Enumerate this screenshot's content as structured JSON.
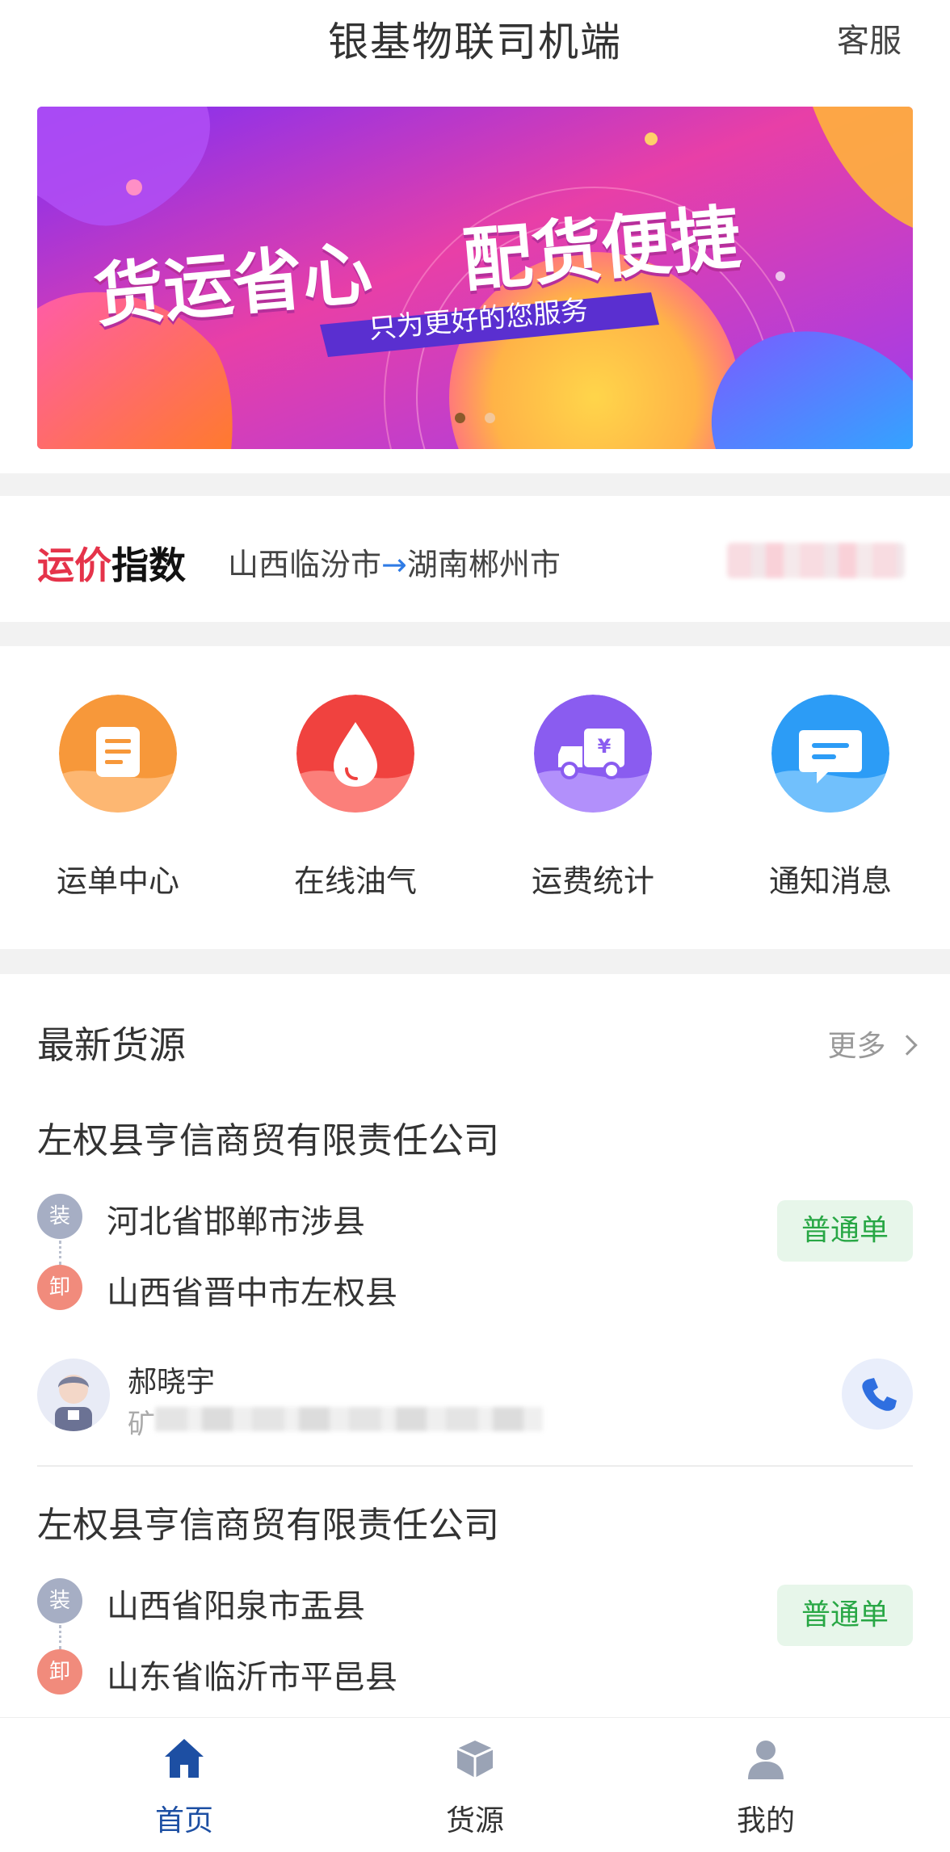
{
  "header": {
    "title": "银基物联司机端",
    "service_label": "客服"
  },
  "banner": {
    "headline_left": "货运省心",
    "headline_right": "配货便捷",
    "sub": "只为更好的您服务",
    "slide_count": 2,
    "active_slide": 1
  },
  "price_index": {
    "logo_red": "运价",
    "logo_black": "指数",
    "route_from": "山西临汾市",
    "route_arrow": "→",
    "route_to": "湖南郴州市"
  },
  "quick_menu": [
    {
      "label": "运单中心",
      "icon": "order-doc-icon",
      "color": "#f7983a"
    },
    {
      "label": "在线油气",
      "icon": "fuel-drop-icon",
      "color": "#f0423f"
    },
    {
      "label": "运费统计",
      "icon": "truck-yen-icon",
      "color": "#8a5cf0"
    },
    {
      "label": "通知消息",
      "icon": "message-bubble-icon",
      "color": "#2c9cf6"
    }
  ],
  "latest_sources": {
    "title": "最新货源",
    "more_label": "更多",
    "cards": [
      {
        "company": "左权县亨信商贸有限责任公司",
        "load_tag": "装",
        "load_address": "河北省邯郸市涉县",
        "unload_tag": "卸",
        "unload_address": "山西省晋中市左权县",
        "badge": "普通单",
        "contact_name": "郝晓宇",
        "contact_detail_lead": "矿"
      },
      {
        "company": "左权县亨信商贸有限责任公司",
        "load_tag": "装",
        "load_address": "山西省阳泉市盂县",
        "unload_tag": "卸",
        "unload_address": "山东省临沂市平邑县",
        "badge": "普通单"
      }
    ]
  },
  "tabbar": [
    {
      "label": "首页",
      "icon": "home-icon",
      "active": true
    },
    {
      "label": "货源",
      "icon": "cargo-box-icon",
      "active": false
    },
    {
      "label": "我的",
      "icon": "user-icon",
      "active": false
    }
  ]
}
